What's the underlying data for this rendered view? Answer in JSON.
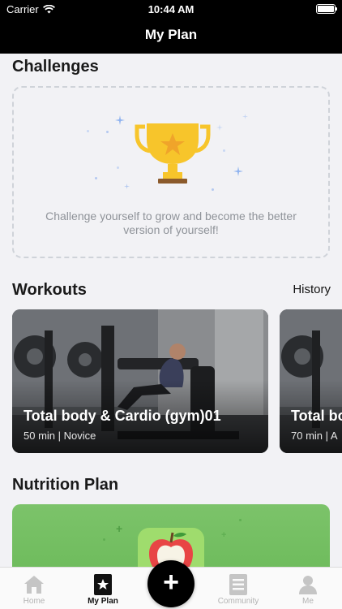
{
  "status": {
    "carrier": "Carrier",
    "time": "10:44 AM",
    "battery_level": 1.0
  },
  "nav": {
    "title": "My Plan"
  },
  "challenges": {
    "title": "Challenges",
    "message": "Challenge yourself to grow and become the better version of yourself!"
  },
  "workouts": {
    "title": "Workouts",
    "history_label": "History",
    "cards": [
      {
        "name": "Total body & Cardio (gym)01",
        "meta": "50 min | Novice"
      },
      {
        "name": "Total bo",
        "meta": "70 min | A"
      }
    ]
  },
  "nutrition": {
    "title": "Nutrition Plan"
  },
  "tabbar": {
    "tabs": [
      {
        "label": "Home",
        "icon": "home-icon"
      },
      {
        "label": "My Plan",
        "icon": "star-doc-icon",
        "active": true
      },
      {
        "label": "Community",
        "icon": "list-icon"
      },
      {
        "label": "Me",
        "icon": "person-icon"
      }
    ],
    "fab_icon": "plus-icon",
    "fab_label": "+"
  },
  "colors": {
    "accent": "#000000",
    "nutrition_green": "#72bf60",
    "trophy_gold": "#f7c52b"
  }
}
